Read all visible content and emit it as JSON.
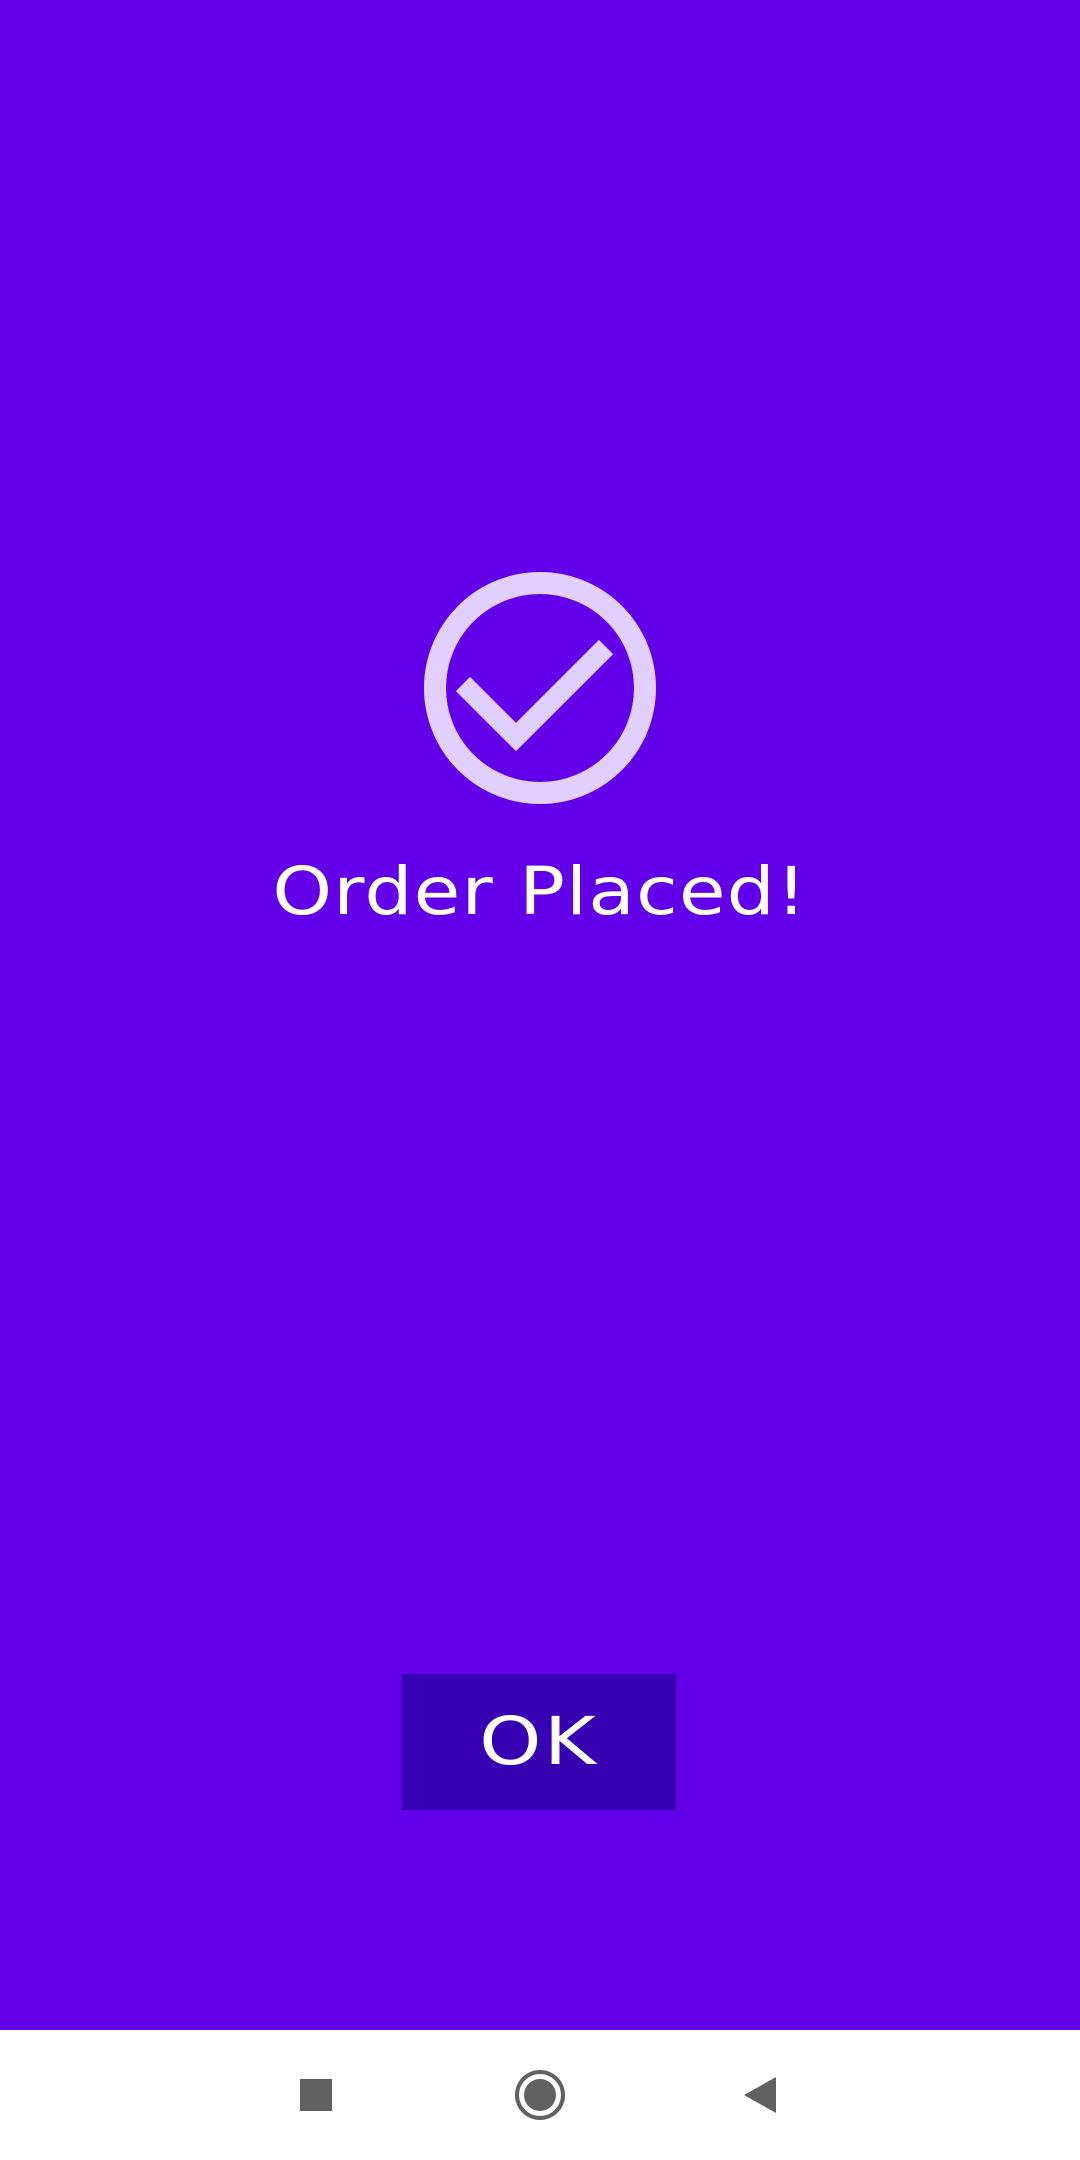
{
  "screen": {
    "background_color": "#6200EA",
    "success_icon": {
      "name": "check-circle-icon",
      "color": "#E1CFFF"
    },
    "title": "Order Placed!",
    "ok_button": {
      "label": "OK",
      "background_color": "#3700B3"
    }
  },
  "nav_bar": {
    "background_color": "#FFFFFF",
    "icon_color": "#616161",
    "buttons": [
      {
        "icon": "square-recents-icon"
      },
      {
        "icon": "circle-home-icon"
      },
      {
        "icon": "triangle-back-icon"
      }
    ]
  }
}
